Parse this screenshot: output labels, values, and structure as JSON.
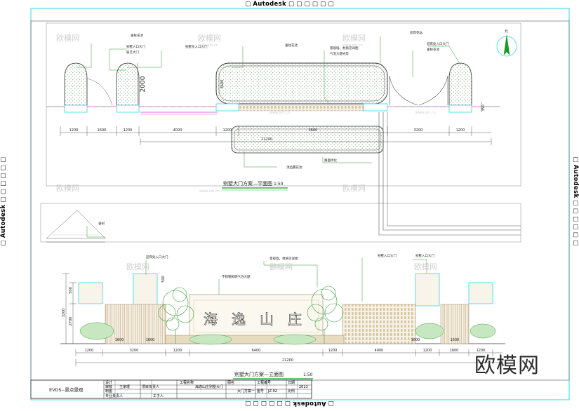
{
  "banner": {
    "prefix": "□",
    "brand": "Autodesk",
    "suffix": "□ □ □ □ □ □"
  },
  "watermark": {
    "logo": "欧模网",
    "site": "www.om.cn"
  },
  "plan": {
    "title": "别墅大门方案—平面图",
    "scale": "1:50",
    "north": "北",
    "dims_top": [
      "1200",
      "1600",
      "1200",
      "4000",
      "1200",
      "3600",
      "3200",
      "1200"
    ],
    "dim_overall": "21200",
    "dim_vertical": "2000",
    "dim_small": "3600",
    "dim_side": "350",
    "labels": [
      "垂柱花池",
      "别墅入口大门",
      "铁艺大门",
      "别墅东入口大门",
      "垂柱花池",
      "景观墙，材质见详图",
      "气泡大题光泵",
      "迎宾花坛",
      "迎宾处入口大门",
      "垂柱花池",
      "顶边薧花池",
      "路面绿化"
    ]
  },
  "elevation": {
    "title": "别墅大门方案—立面图",
    "scale": "1:50",
    "sign_chars": [
      "海",
      "逸",
      "山",
      "庄"
    ],
    "dims_bottom": [
      "1200",
      "3200",
      "1200",
      "6400",
      "1200",
      "4000",
      "1200",
      "1600",
      "1200"
    ],
    "dims_inner": [
      "1600",
      "1600",
      "1600",
      "1600"
    ],
    "dim_overall": "21200",
    "dims_left": [
      "500",
      "2700",
      "3200"
    ],
    "dim_post": "500",
    "labels": [
      "迎宾处入口大门",
      "景观墙，材质见详图",
      "不锈钢照明气泡大题",
      "别墅入口大门",
      "别墅入口大门",
      "垂树"
    ]
  },
  "title_block": {
    "company": "EVDS--景点景观",
    "cells": [
      "设计",
      "审核",
      "制图",
      "专业负责人",
      "王家珉",
      "项目负责人",
      "工程名称",
      "工子人",
      "海逸山庄别墅大门",
      "图名",
      "大门方案一",
      "工程编号",
      "图号",
      "日期",
      "比例",
      "JZ-02",
      "2013"
    ]
  }
}
